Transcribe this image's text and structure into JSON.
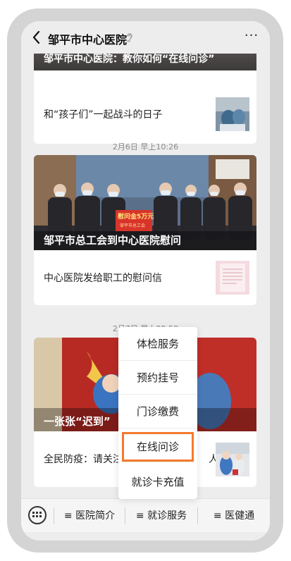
{
  "header": {
    "title": "邹平市中心医院",
    "more_label": "···"
  },
  "feed": [
    {
      "cover_title": "邹平市中心医院：教你如何“在线问诊”",
      "row_text": "和“孩子们”一起战斗的日子"
    },
    {
      "timestamp": "2月6日 早上10:26",
      "cover_title": "邹平市总工会到中心医院慰问",
      "banner_text": "慰问金5万元",
      "banner_sub": "邹平市总工会",
      "row_text": "中心医院发给职工的慰问信"
    },
    {
      "timestamp": "2月7日 早上09:58",
      "cover_title": "一张张“迟到”",
      "row_text": "全民防疫：请关注那些",
      "row_text_tail": "人"
    }
  ],
  "popup_menu": {
    "items": [
      {
        "label": "体检服务"
      },
      {
        "label": "预约挂号"
      },
      {
        "label": "门诊缴费"
      },
      {
        "label": "在线问诊",
        "highlighted": true
      },
      {
        "label": "就诊卡充值"
      }
    ],
    "highlight_color": "#f47a2c"
  },
  "bottom_menu": [
    {
      "label": "≡ 医院简介"
    },
    {
      "label": "≡ 就诊服务"
    },
    {
      "label": "≡ 医健通"
    }
  ],
  "icons": [
    "back-arrow-icon",
    "ear-icon",
    "more-icon",
    "keyboard-icon"
  ]
}
